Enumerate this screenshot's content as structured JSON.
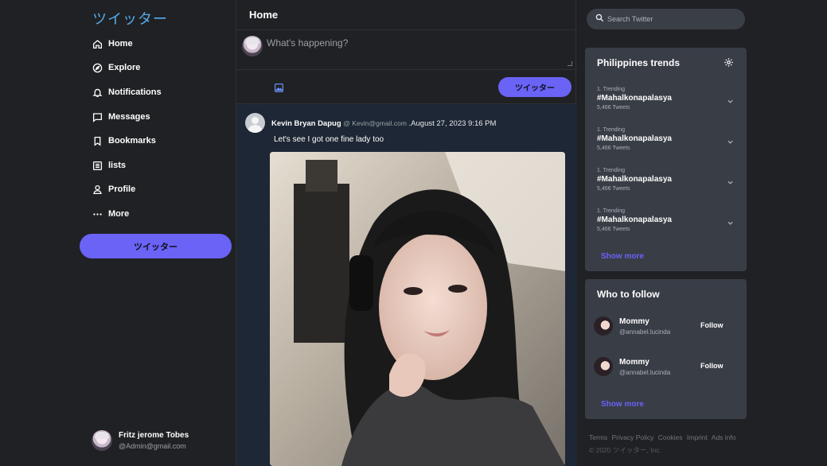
{
  "app": {
    "logo": "ツイッター",
    "accent": "#6a63f6"
  },
  "sidebar": {
    "items": [
      {
        "label": "Home",
        "icon": "home-icon"
      },
      {
        "label": "Explore",
        "icon": "compass-icon"
      },
      {
        "label": "Notifications",
        "icon": "bell-icon"
      },
      {
        "label": "Messages",
        "icon": "message-icon"
      },
      {
        "label": "Bookmarks",
        "icon": "bookmark-icon"
      },
      {
        "label": "lists",
        "icon": "list-icon"
      },
      {
        "label": "Profile",
        "icon": "user-icon"
      },
      {
        "label": "More",
        "icon": "more-icon"
      }
    ],
    "tweet_button": "ツイッター",
    "user": {
      "name": "Fritz jerome Tobes",
      "email": "@Admin@gmail.com"
    }
  },
  "main": {
    "title": "Home",
    "composer": {
      "placeholder": "What's happening?",
      "tweet_button": "ツイッター"
    },
    "post": {
      "author": "Kevin Bryan Dapug",
      "handle": "@ Kevin@gmail.com",
      "date": ".August 27, 2023 9:16 PM",
      "text": "Let's see I got one fine lady too"
    }
  },
  "right": {
    "search": {
      "placeholder": "Search Twitter"
    },
    "trends": {
      "title": "Philippines trends",
      "items": [
        {
          "rank": "1. Trending",
          "tag": "#Mahalkonapalasya",
          "count": "5,466 Tweets"
        },
        {
          "rank": "1. Trending",
          "tag": "#Mahalkonapalasya",
          "count": "5,466 Tweets"
        },
        {
          "rank": "1. Trending",
          "tag": "#Mahalkonapalasya",
          "count": "5,466 Tweets"
        },
        {
          "rank": "1. Trending",
          "tag": "#Mahalkonapalasya",
          "count": "5,466 Tweets"
        }
      ],
      "show_more": "Show more"
    },
    "who_to_follow": {
      "title": "Who to follow",
      "items": [
        {
          "name": "Mommy",
          "handle": "@annabel.lucinda",
          "button": "Follow"
        },
        {
          "name": "Mommy",
          "handle": "@annabel.lucinda",
          "button": "Follow"
        }
      ],
      "show_more": "Show more"
    },
    "footer": {
      "links": [
        "Terms",
        "Privacy Policy",
        "Cookies",
        "Imprint",
        "Ads info"
      ],
      "copyright": "© 2020 ツイッター, Inc."
    }
  }
}
